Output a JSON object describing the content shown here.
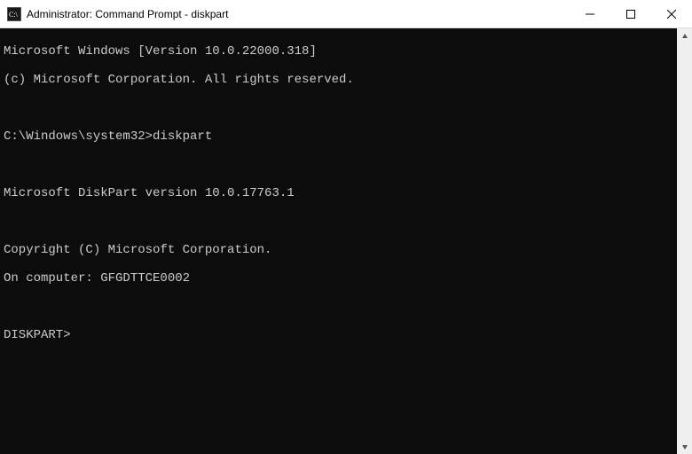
{
  "window": {
    "title": "Administrator: Command Prompt - diskpart"
  },
  "terminal": {
    "line1": "Microsoft Windows [Version 10.0.22000.318]",
    "line2": "(c) Microsoft Corporation. All rights reserved.",
    "prompt_line": "C:\\Windows\\system32>diskpart",
    "diskpart_version": "Microsoft DiskPart version 10.0.17763.1",
    "copyright": "Copyright (C) Microsoft Corporation.",
    "computer_line": "On computer: GFGDTTCE0002",
    "diskpart_prompt": "DISKPART>"
  }
}
